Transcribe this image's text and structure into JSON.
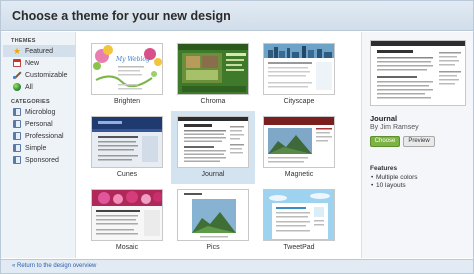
{
  "title": "Choose a theme for your new design",
  "sidebar": {
    "themes_heading": "THEMES",
    "theme_filters": [
      {
        "label": "Featured",
        "icon": "star-icon",
        "active": true
      },
      {
        "label": "New",
        "icon": "calendar-icon",
        "active": false
      },
      {
        "label": "Customizable",
        "icon": "paintbrush-icon",
        "active": false
      },
      {
        "label": "All",
        "icon": "globe-icon",
        "active": false
      }
    ],
    "categories_heading": "CATEGORIES",
    "categories": [
      {
        "label": "Microblog",
        "icon": "category-icon"
      },
      {
        "label": "Personal",
        "icon": "category-icon"
      },
      {
        "label": "Professional",
        "icon": "category-icon"
      },
      {
        "label": "Simple",
        "icon": "category-icon"
      },
      {
        "label": "Sponsored",
        "icon": "category-icon"
      }
    ]
  },
  "themes": [
    {
      "name": "Brighten",
      "selected": false
    },
    {
      "name": "Chroma",
      "selected": false
    },
    {
      "name": "Cityscape",
      "selected": false
    },
    {
      "name": "Cunes",
      "selected": false
    },
    {
      "name": "Journal",
      "selected": true
    },
    {
      "name": "Magnetic",
      "selected": false
    },
    {
      "name": "Mosaic",
      "selected": false
    },
    {
      "name": "Pics",
      "selected": false
    },
    {
      "name": "TweetPad",
      "selected": false
    }
  ],
  "preview": {
    "name": "Journal",
    "author": "By Jim Ramsey",
    "choose_label": "Choose",
    "preview_label": "Preview",
    "features_heading": "Features",
    "features": [
      "Multiple colors",
      "10 layouts"
    ]
  },
  "footer": {
    "back_link": "« Return to the design overview"
  },
  "colors": {
    "accent": "#2a5db0",
    "choose_button": "#7cb342",
    "selected_bg": "#d4e3f0",
    "header_bg": "#e2ebf4"
  }
}
